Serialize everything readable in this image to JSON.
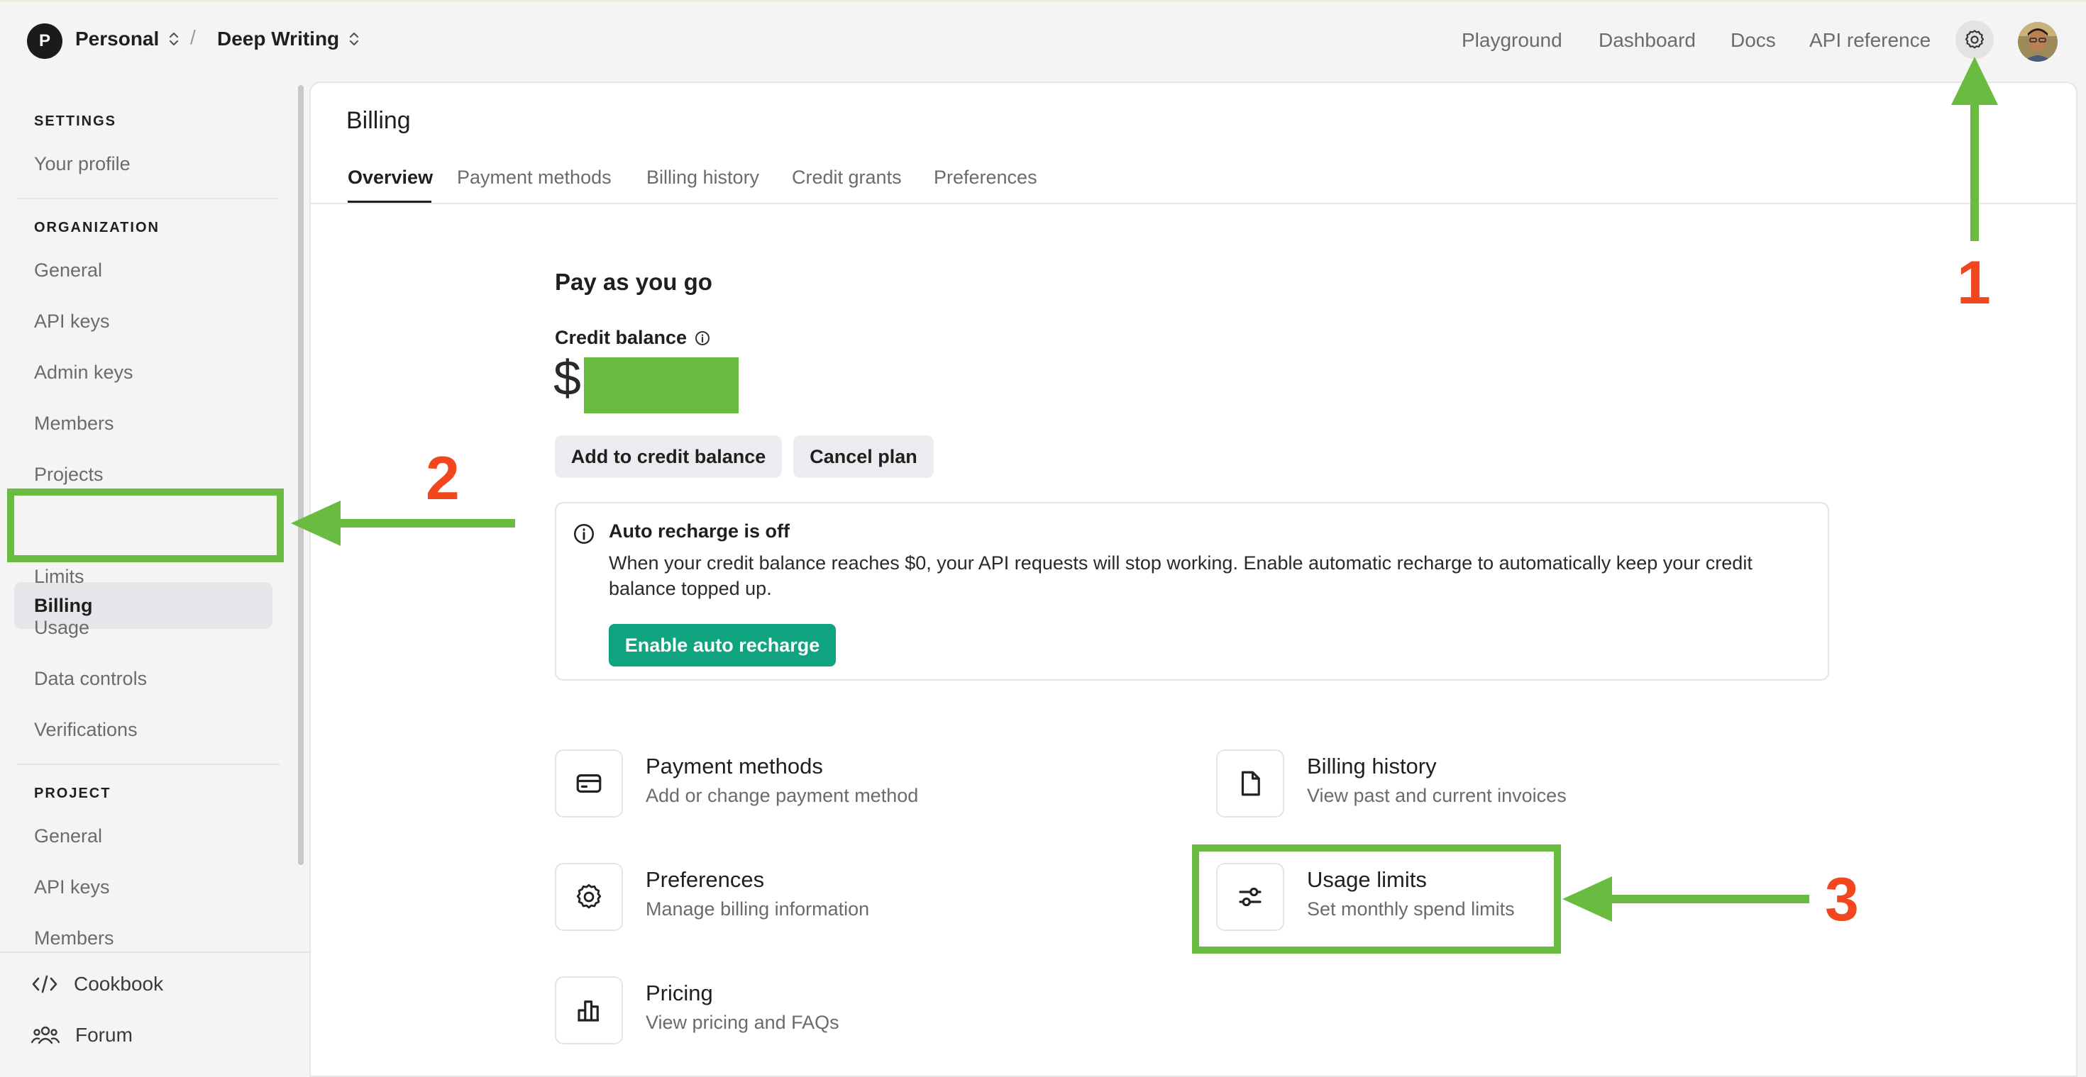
{
  "topbar": {
    "org_initial": "P",
    "org_name": "Personal",
    "separator": "/",
    "project_name": "Deep Writing",
    "nav": [
      "Playground",
      "Dashboard",
      "Docs",
      "API reference"
    ],
    "settings_icon": "gear-icon",
    "avatar_icon": "user-avatar"
  },
  "sidebar": {
    "settings_heading": "SETTINGS",
    "settings_items": [
      "Your profile"
    ],
    "organization_heading": "ORGANIZATION",
    "organization_items": [
      "General",
      "API keys",
      "Admin keys",
      "Members",
      "Projects",
      "Billing",
      "Limits",
      "Usage",
      "Data controls",
      "Verifications"
    ],
    "active_item": "Billing",
    "project_heading": "PROJECT",
    "project_items": [
      "General",
      "API keys",
      "Members"
    ],
    "footer": [
      {
        "label": "Cookbook",
        "icon": "code-icon"
      },
      {
        "label": "Forum",
        "icon": "people-icon"
      }
    ]
  },
  "main": {
    "title": "Billing",
    "tabs": [
      "Overview",
      "Payment methods",
      "Billing history",
      "Credit grants",
      "Preferences"
    ],
    "active_tab": "Overview",
    "plan_heading": "Pay as you go",
    "credit_label": "Credit balance",
    "credit_currency": "$",
    "buttons": {
      "add_credit": "Add to credit balance",
      "cancel_plan": "Cancel plan"
    },
    "notice": {
      "title": "Auto recharge is off",
      "body": "When your credit balance reaches $0, your API requests will stop working. Enable automatic recharge to automatically keep your credit balance topped up.",
      "button": "Enable auto recharge"
    },
    "cards": [
      {
        "title": "Payment methods",
        "subtitle": "Add or change payment method",
        "icon": "credit-card-icon"
      },
      {
        "title": "Billing history",
        "subtitle": "View past and current invoices",
        "icon": "document-icon"
      },
      {
        "title": "Preferences",
        "subtitle": "Manage billing information",
        "icon": "gear-icon"
      },
      {
        "title": "Usage limits",
        "subtitle": "Set monthly spend limits",
        "icon": "sliders-icon"
      },
      {
        "title": "Pricing",
        "subtitle": "View pricing and FAQs",
        "icon": "bar-chart-icon"
      }
    ]
  },
  "annotations": {
    "labels": [
      "1",
      "2",
      "3"
    ],
    "highlight_color": "#6abc41",
    "number_color": "#f2461f"
  },
  "colors": {
    "accent_green": "#10a37f"
  }
}
